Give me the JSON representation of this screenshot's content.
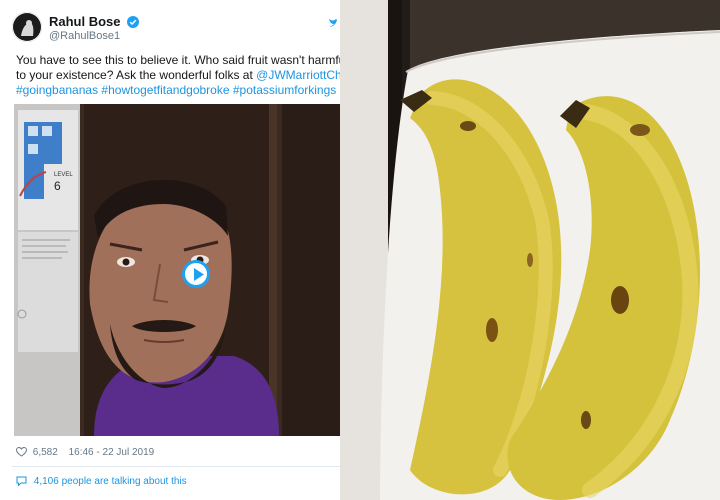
{
  "tweet": {
    "author_name": "Rahul Bose",
    "author_handle": "@RahulBose1",
    "text_line1": "You have to see this to believe it. Who said fruit wasn't harmful",
    "text_line2_prefix": "to your existence? Ask the wonderful folks at ",
    "text_line2_link": "@JWMarriottChd",
    "hashtags": [
      "#goingbananas",
      "#howtogetfitandgobroke",
      "#potassiumforkings"
    ],
    "video_sign_text": "LEVEL",
    "video_sign_number": "6",
    "likes": "6,582",
    "timestamp": "16:46 - 22 Jul 2019",
    "talking": "4,106 people are talking about this"
  },
  "icons": [
    "verified-icon",
    "twitter-bird-icon",
    "play-icon",
    "heart-icon",
    "comment-bubble-icon"
  ],
  "colors": {
    "link": "#1b95e0",
    "verified": "#1da1f2",
    "banana": "#d9c23a",
    "plate": "#f4f2ee"
  }
}
